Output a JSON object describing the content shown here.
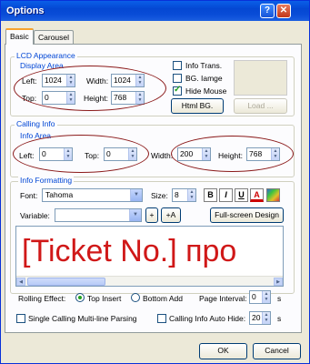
{
  "window": {
    "title": "Options"
  },
  "tabs": [
    {
      "label": "Basic"
    },
    {
      "label": "Carousel"
    }
  ],
  "lcd": {
    "group_label": "LCD Appearance",
    "display_label": "Display Area",
    "left_label": "Left:",
    "left": "1024",
    "width_label": "Width:",
    "width": "1024",
    "top_label": "Top:",
    "top": "0",
    "height_label": "Height:",
    "height": "768",
    "info_trans": "Info Trans.",
    "bg_image": "BG. Iamge",
    "hide_mouse": "Hide Mouse",
    "html_bg": "Html BG.",
    "load": "Load ..."
  },
  "calling": {
    "group_label": "Calling Info",
    "area_label": "Info Area",
    "left_label": "Left:",
    "left": "0",
    "top_label": "Top:",
    "top": "0",
    "width_label": "Width:",
    "width": "200",
    "height_label": "Height:",
    "height": "768"
  },
  "formatting": {
    "group_label": "Info Formatting",
    "font_label": "Font:",
    "font": "Tahoma",
    "size_label": "Size:",
    "size": "8",
    "bold": "B",
    "italic": "I",
    "underline": "U",
    "color_letter": "A",
    "variable_label": "Variable:",
    "variable": "",
    "add": "+",
    "add_a": "+A",
    "fullscreen": "Full-screen Design",
    "preview_text": "[Ticket No.] про"
  },
  "rolling": {
    "label": "Rolling Effect:",
    "top_insert": "Top Insert",
    "bottom_add": "Bottom Add",
    "page_interval_label": "Page Interval:",
    "page_interval": "0",
    "page_unit": "s"
  },
  "bottom_opts": {
    "single_calling": "Single Calling Multi-line Parsing",
    "auto_hide": "Calling Info Auto Hide:",
    "auto_hide_value": "20",
    "auto_hide_unit": "s"
  },
  "footer": {
    "ok": "OK",
    "cancel": "Cancel"
  },
  "colors": {
    "accent": "#0046d5",
    "preview_text": "#d01818",
    "title_bar": "#0a4dd8"
  }
}
